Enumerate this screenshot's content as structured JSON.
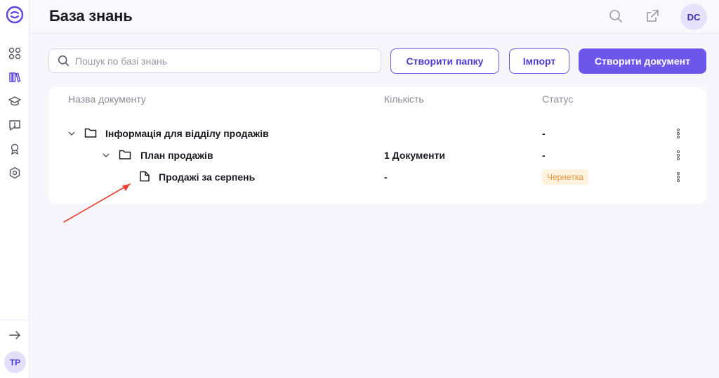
{
  "header": {
    "title": "База знань",
    "avatar_initials": "DC"
  },
  "sidebar": {
    "items": [
      {
        "icon": "grid-icon"
      },
      {
        "icon": "library-icon",
        "active": true
      },
      {
        "icon": "graduation-cap-icon"
      },
      {
        "icon": "message-alert-icon"
      },
      {
        "icon": "award-icon"
      },
      {
        "icon": "settings-hexagon-icon"
      }
    ],
    "expand_icon": "arrow-right-icon",
    "user_initials": "TP"
  },
  "toolbar": {
    "search_placeholder": "Пошук по базі знань",
    "create_folder_label": "Створити папку",
    "import_label": "Імпорт",
    "create_document_label": "Створити документ"
  },
  "table": {
    "columns": {
      "name": "Назва документу",
      "count": "Кількість",
      "status": "Статус"
    },
    "rows": [
      {
        "name": "Інформація для відділу продажів",
        "count": "",
        "status": "-",
        "type": "folder",
        "level": 0
      },
      {
        "name": "План продажів",
        "count": "1 Документи",
        "status": "-",
        "type": "folder",
        "level": 1
      },
      {
        "name": "Продажі за серпень",
        "count": "-",
        "status": "Чернетка",
        "type": "document",
        "level": 2
      }
    ]
  },
  "colors": {
    "accent": "#6c57ea",
    "draft_badge_bg": "#fff3e0",
    "draft_badge_text": "#e8943a",
    "annotation_arrow": "#e8402f"
  }
}
